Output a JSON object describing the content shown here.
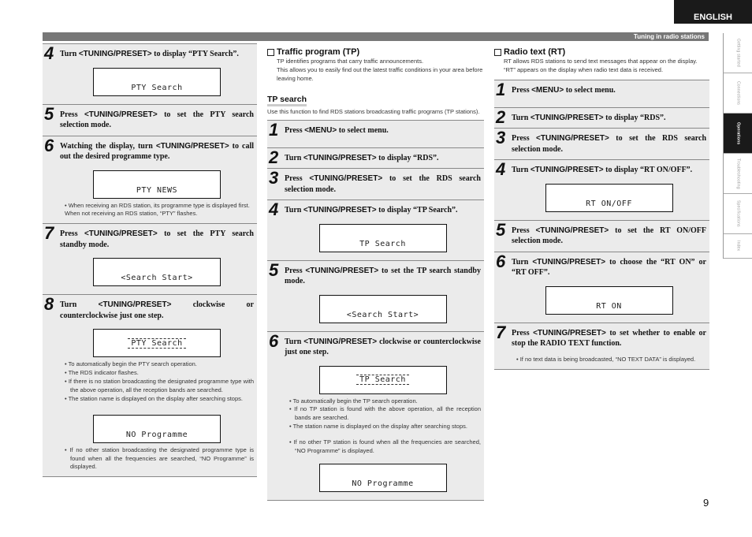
{
  "language_tab": "ENGLISH",
  "header": {
    "section": "Tuning in radio stations"
  },
  "side_nav": [
    {
      "label": "Getting started",
      "active": false
    },
    {
      "label": "Connections",
      "active": false
    },
    {
      "label": "Operations",
      "active": true
    },
    {
      "label": "Troubleshooting",
      "active": false
    },
    {
      "label": "Specifications",
      "active": false
    },
    {
      "label": "Index",
      "active": false
    }
  ],
  "col1": {
    "steps": [
      {
        "num": "4",
        "pre": "Turn ",
        "key": "<TUNING/PRESET>",
        "post": " to display “PTY Search”.",
        "lcd": "PTY Search"
      },
      {
        "num": "5",
        "pre": "Press ",
        "key": "<TUNING/PRESET>",
        "post": " to set the PTY search selection mode."
      },
      {
        "num": "6",
        "pre": "Watching the display, turn ",
        "key": "<TUNING/PRESET>",
        "post": " to call out the desired programme type.",
        "lcd": "PTY NEWS",
        "notes": [
          "When receiving an RDS station, its programme type is displayed first.",
          "When not receiving an RDS station, “PTY” flashes."
        ]
      },
      {
        "num": "7",
        "pre": "Press ",
        "key": "<TUNING/PRESET>",
        "post": " to set the PTY search standby mode.",
        "lcd": "<Search Start>"
      },
      {
        "num": "8",
        "pre": "Turn ",
        "key": "<TUNING/PRESET>",
        "post": " clockwise or counterclockwise just one step.",
        "lcd": "PTY Search",
        "notes": [
          "To automatically begin the PTY search operation.",
          "The RDS indicator flashes.",
          "If there is no station broadcasting the designated programme type with the above operation, all the reception bands are searched.",
          "The station name is displayed on the display after searching stops."
        ],
        "lcd2": "NO Programme",
        "notes2": [
          "If no other station broadcasting the designated programme type is found when all the frequencies are searched, “NO Programme” is displayed."
        ]
      }
    ]
  },
  "col2": {
    "title": "Traffic program (TP)",
    "intro": [
      "TP identifies programs that carry traffic announcements.",
      "This allows you to easily find out the latest traffic conditions in your area before leaving home."
    ],
    "subtitle": "TP search",
    "sub_intro": "Use this function to find RDS stations broadcasting traffic programs (TP stations).",
    "steps": [
      {
        "num": "1",
        "pre": "Press ",
        "key": "<MENU>",
        "post": " to select menu."
      },
      {
        "num": "2",
        "pre": "Turn ",
        "key": "<TUNING/PRESET>",
        "post": " to display “RDS”."
      },
      {
        "num": "3",
        "pre": "Press ",
        "key": "<TUNING/PRESET>",
        "post": " to set the RDS search selection mode."
      },
      {
        "num": "4",
        "pre": "Turn ",
        "key": "<TUNING/PRESET>",
        "post": " to display “TP Search”.",
        "lcd": "TP Search"
      },
      {
        "num": "5",
        "pre": "Press ",
        "key": "<TUNING/PRESET>",
        "post": " to set the TP search standby mode.",
        "lcd": "<Search Start>"
      },
      {
        "num": "6",
        "pre": "Turn ",
        "key": "<TUNING/PRESET>",
        "post": " clockwise or counterclockwise just one step.",
        "lcd": "TP Search",
        "notes": [
          "To automatically begin the TP search operation.",
          "If no TP station is found with the above operation, all the reception bands are searched.",
          "The station name is displayed on the display after searching stops."
        ],
        "notes2": [
          "If no other TP station is found when all the frequencies are searched, “NO Programme” is displayed."
        ],
        "lcd2": "NO Programme"
      }
    ]
  },
  "col3": {
    "title": "Radio text (RT)",
    "intro": [
      "RT allows RDS stations to send text messages that appear on the display.",
      "“RT” appears on the display when radio text data is received."
    ],
    "steps": [
      {
        "num": "1",
        "pre": "Press ",
        "key": "<MENU>",
        "post": " to select menu."
      },
      {
        "num": "2",
        "pre": "Turn ",
        "key": "<TUNING/PRESET>",
        "post": " to display “RDS”."
      },
      {
        "num": "3",
        "pre": "Press ",
        "key": "<TUNING/PRESET>",
        "post": " to set the RDS search selection mode."
      },
      {
        "num": "4",
        "pre": "Turn ",
        "key": "<TUNING/PRESET>",
        "post": " to display “RT ON/OFF”.",
        "lcd": "RT ON/OFF"
      },
      {
        "num": "5",
        "pre": "Press ",
        "key": "<TUNING/PRESET>",
        "post": " to set the RT ON/OFF selection mode."
      },
      {
        "num": "6",
        "pre": "Turn ",
        "key": "<TUNING/PRESET>",
        "post": " to choose the “RT ON” or “RT OFF”.",
        "lcd": "RT ON"
      },
      {
        "num": "7",
        "pre": "Press ",
        "key": "<TUNING/PRESET>",
        "post": " to set whether to enable or stop the RADIO TEXT function.",
        "notes": [
          "If no text data is being broadcasted, “NO TEXT DATA” is displayed."
        ]
      }
    ]
  },
  "page_number": "9"
}
